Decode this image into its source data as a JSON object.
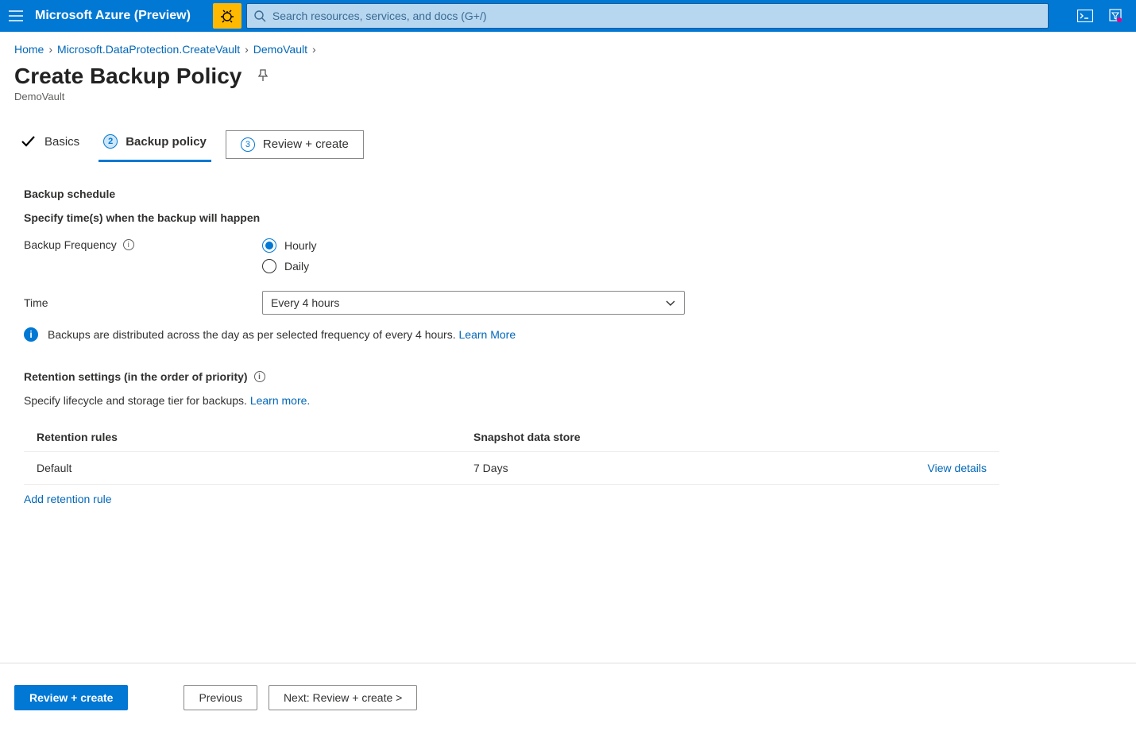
{
  "header": {
    "brand": "Microsoft Azure (Preview)",
    "search_placeholder": "Search resources, services, and docs (G+/)"
  },
  "breadcrumb": {
    "items": [
      "Home",
      "Microsoft.DataProtection.CreateVault",
      "DemoVault"
    ]
  },
  "page": {
    "title": "Create Backup Policy",
    "subtitle": "DemoVault"
  },
  "tabs": {
    "basics": "Basics",
    "policy_num": "2",
    "policy": "Backup policy",
    "review_num": "3",
    "review": "Review + create"
  },
  "schedule": {
    "heading": "Backup schedule",
    "subheading": "Specify time(s) when the backup will happen",
    "freq_label": "Backup Frequency",
    "freq_options": {
      "hourly": "Hourly",
      "daily": "Daily"
    },
    "time_label": "Time",
    "time_value": "Every 4 hours",
    "info_text": "Backups are distributed across the day as per selected frequency of every 4 hours.",
    "info_link": "Learn More"
  },
  "retention": {
    "heading": "Retention settings (in the order of priority)",
    "subheading": "Specify lifecycle and storage tier for backups.",
    "learn_more": "Learn more.",
    "columns": {
      "rules": "Retention rules",
      "snapshot": "Snapshot data store"
    },
    "row": {
      "name": "Default",
      "snapshot": "7 Days",
      "action": "View details"
    },
    "add_rule": "Add retention rule"
  },
  "footer": {
    "primary": "Review + create",
    "previous": "Previous",
    "next": "Next: Review + create >"
  }
}
